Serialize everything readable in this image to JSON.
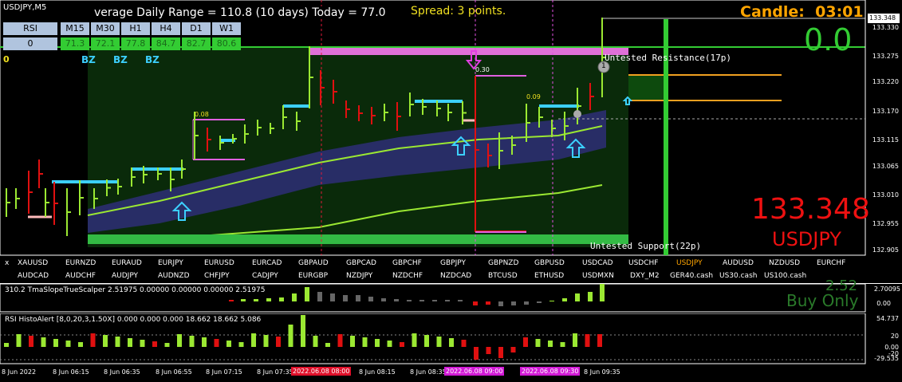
{
  "window": {
    "title": "USDJPY,M5"
  },
  "header": {
    "adr_text": "verage Daily Range = 110.8 (10 days)   Today = 77.0",
    "spread_text": "Spread: 3 points.",
    "candle_label": "Candle:",
    "candle_time": "03:01",
    "big_value": "0.0"
  },
  "rsi_table": {
    "title": "RSI",
    "timeframes": [
      "M15",
      "M30",
      "H1",
      "H4",
      "D1",
      "W1"
    ],
    "row_label": "0",
    "values": [
      "71.3",
      "72.1",
      "77.8",
      "84.7",
      "82.7",
      "80.6"
    ],
    "signals": [
      "BZ",
      "BZ",
      "BZ"
    ],
    "left_marker": "0"
  },
  "annotations": {
    "resistance": "Untested Resistance(17p)",
    "support": "Untested Support(22p)",
    "label_030": "0.30",
    "label_008": "0.08",
    "label_009": "0.09",
    "marker_1": "1"
  },
  "price_info": {
    "price": "133.348",
    "symbol": "USDJPY"
  },
  "price_axis": [
    "133.330",
    "133.275",
    "133.220",
    "133.170",
    "133.115",
    "133.065",
    "133.010",
    "132.955",
    "132.905"
  ],
  "price_current": "133.348",
  "symbols": {
    "row1": [
      "XAUUSD",
      "EURNZD",
      "EURAUD",
      "EURJPY",
      "EURUSD",
      "EURCAD",
      "GBPAUD",
      "GBPCAD",
      "GBPCHF",
      "GBPJPY",
      "GBPNZD",
      "GBPUSD",
      "USDCAD",
      "USDCHF",
      "USDJPY",
      "AUDUSD",
      "NZDUSD",
      "EURCHF"
    ],
    "row2": [
      "AUDCAD",
      "AUDCHF",
      "AUDJPY",
      "AUDNZD",
      "CHFJPY",
      "CADJPY",
      "EURGBP",
      "NZDJPY",
      "NZDCHF",
      "NZDCAD",
      "BTCUSD",
      "ETHUSD",
      "USDMXN",
      "DXY_M2",
      "GER40.cash",
      "US30.cash",
      "US100.cash"
    ],
    "active": "USDJPY",
    "close_label": "x"
  },
  "indicator1": {
    "title": "310.2 TmaSlopeTrueScalper 2.51975 0.00000 0.00000 0.00000 2.51975",
    "status": "Buy Only",
    "partial_value": "2.52",
    "axis": [
      "2.70095",
      "0.00"
    ]
  },
  "indicator2": {
    "title": "RSI HistoAlert [8,0,20,3,1.50X] 0.000 0.000 0.000 18.662 18.662 5.086",
    "axis": [
      "54.737",
      "20",
      "0.00",
      "-20",
      "-29.535"
    ]
  },
  "time_axis": {
    "labels": [
      "8 Jun 2022",
      "8 Jun 06:15",
      "8 Jun 06:35",
      "8 Jun 06:55",
      "8 Jun 07:15",
      "8 Jun 07:35",
      "8 Jun 08:15",
      "8 Jun 08:35",
      "8 Jun 09:35"
    ],
    "badges": [
      "2022.06.08 08:00",
      "2022.06.08 09:00",
      "2022.06.08 09:30"
    ],
    "badge_colors": [
      "#e0102a",
      "#d21ad6",
      "#d21ad6"
    ]
  },
  "colors": {
    "bull": "#9be832",
    "bear": "#e01010",
    "band": "#2b2e6e",
    "cyan": "#3cd0ff",
    "magenta": "#e060e0",
    "green_bar": "#33cc33",
    "orange": "#f0a020",
    "price_red": "#ee1111",
    "candle_orange": "#ffa500"
  },
  "icons": [
    "up-arrow-icon",
    "down-arrow-icon",
    "close-icon"
  ]
}
